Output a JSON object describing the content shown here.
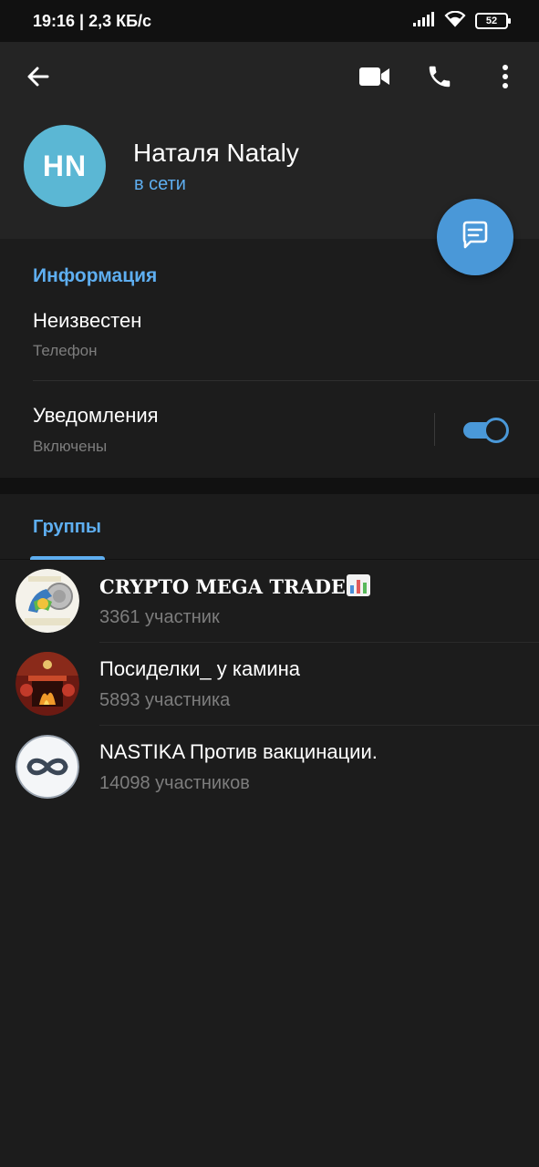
{
  "status_bar": {
    "time": "19:16 | 2,3 КБ/с",
    "battery": "52"
  },
  "header": {
    "icons": [
      "back-arrow-icon",
      "video-camera-icon",
      "phone-icon",
      "more-vertical-icon"
    ]
  },
  "profile": {
    "initials": "HN",
    "avatar_color": "#5bb7d4",
    "name": "Наталя Nataly",
    "status": "в сети",
    "message_fab_icon": "message-icon"
  },
  "info": {
    "title": "Информация",
    "phone_value": "Неизвестен",
    "phone_label": "Телефон",
    "notifications_title": "Уведомления",
    "notifications_state": "Включены",
    "notifications_enabled": true
  },
  "tabs": {
    "groups_label": "Группы"
  },
  "groups": [
    {
      "name": "CRYPTO MEGA TRADE",
      "emoji_icon": "bar-chart-icon",
      "members": "3361 участник"
    },
    {
      "name": "Посиделки_ у камина",
      "members": "5893 участника"
    },
    {
      "name": "NASTIKA Против вакцинации.",
      "members": "14098 участников"
    }
  ],
  "colors": {
    "accent": "#5eaef0",
    "fab": "#4a98d8",
    "background": "#1c1c1c",
    "header": "#242424"
  }
}
